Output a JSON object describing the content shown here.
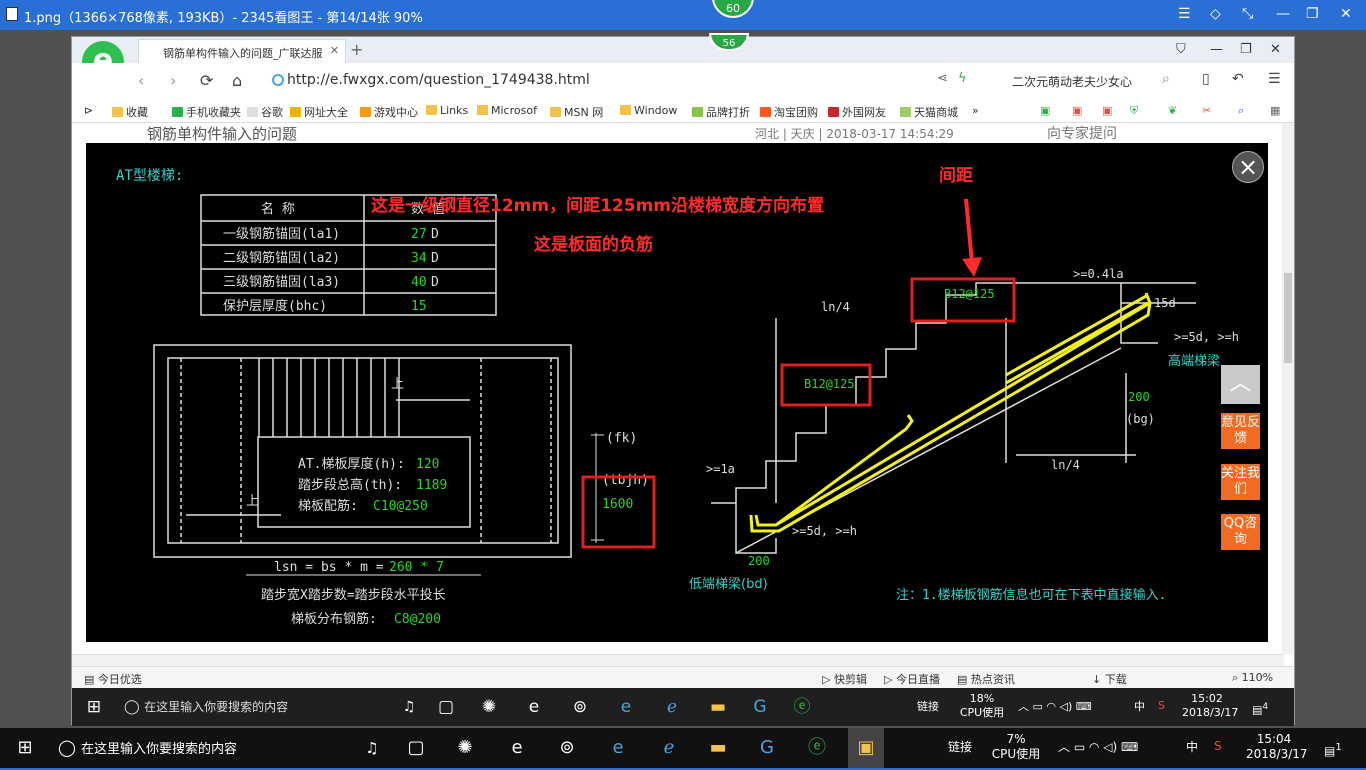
{
  "viewer": {
    "title": "1.png（1366×768像素, 193KB）- 2345看图王 - 第14/14张 90%",
    "badge": "60"
  },
  "browser": {
    "badge": "56",
    "tab_title": "钢筋单构件输入的问题_广联达服",
    "url": "http://e.fwxgx.com/question_1749438.html",
    "search_text": "二次元萌动老夫少女心",
    "bookmarks": [
      "收藏",
      "手机收藏夹",
      "谷歌",
      "网址大全",
      "游戏中心",
      "Links",
      "Microsof",
      "MSN 网",
      "Window",
      "品牌打折",
      "淘宝团购",
      "外国网友",
      "天猫商城"
    ],
    "page_heading": "钢筋单构件输入的问题",
    "page_meta": "河北 | 天庆 | 2018-03-17 14:54:29",
    "page_right": "向专家提问",
    "status": {
      "left": "今日优选",
      "items": [
        "快剪辑",
        "今日直播",
        "热点资讯",
        "下载"
      ],
      "zoom": "110%"
    }
  },
  "cad": {
    "title": "AT型楼梯:",
    "table_header": [
      "名  称",
      "数  值"
    ],
    "table_rows": [
      [
        "一级钢筋锚固(la1)",
        "27",
        "D"
      ],
      [
        "二级钢筋锚固(la2)",
        "34",
        "D"
      ],
      [
        "三级钢筋锚固(la3)",
        "40",
        "D"
      ],
      [
        "保护层厚度(bhc)",
        "15",
        ""
      ]
    ],
    "annot_red1": "这是一级钢直径12mm，间距125mm沿楼梯宽度方向布置",
    "annot_red2": "这是板面的负筋",
    "annot_red3": "间距",
    "stair_params": [
      [
        "AT.梯板厚度(h):",
        "120"
      ],
      [
        "踏步段总高(th):",
        "1189"
      ],
      [
        "梯板配筋:",
        "C10@250"
      ]
    ],
    "up_label": "上",
    "fk": "(fk)",
    "tbjh": "(tbjh)",
    "tbjh_val": "1600",
    "lsn_label": "lsn = bs * m =",
    "lsn_val": "260 * 7",
    "step_label": "踏步宽X踏步数=踏步段水平投长",
    "dist_label": "梯板分布钢筋:",
    "dist_val": "C8@200",
    "rebar_top": "B12@125",
    "rebar_mid": "B12@125",
    "ln4_top": "ln/4",
    "ln4_bot": "ln/4",
    "la_top": ">=0.4la",
    "d15": "15d",
    "d5h_top": ">=5d, >=h",
    "high_beam": "高端梯梁",
    "v200_top": "200",
    "bg": "(bg)",
    "la_left": ">=1a",
    "d5h_bot": ">=5d, >=h",
    "v200_bot": "200",
    "low_beam": "低端梯梁(bd)",
    "note": "注：1.楼梯板钢筋信息也可在下表中直接输入."
  },
  "side_buttons": [
    "意见反馈",
    "关注我们",
    "QQ咨询"
  ],
  "inner_taskbar": {
    "search": "在这里输入你要搜索的内容",
    "link": "链接",
    "cpu": "18%",
    "cpu_label": "CPU使用",
    "ime": "中",
    "time": "15:02",
    "date": "2018/3/17",
    "notif": "4"
  },
  "taskbar": {
    "search": "在这里输入你要搜索的内容",
    "link": "链接",
    "cpu": "7%",
    "cpu_label": "CPU使用",
    "ime": "中",
    "time": "15:04",
    "date": "2018/3/17",
    "notif": "1"
  }
}
